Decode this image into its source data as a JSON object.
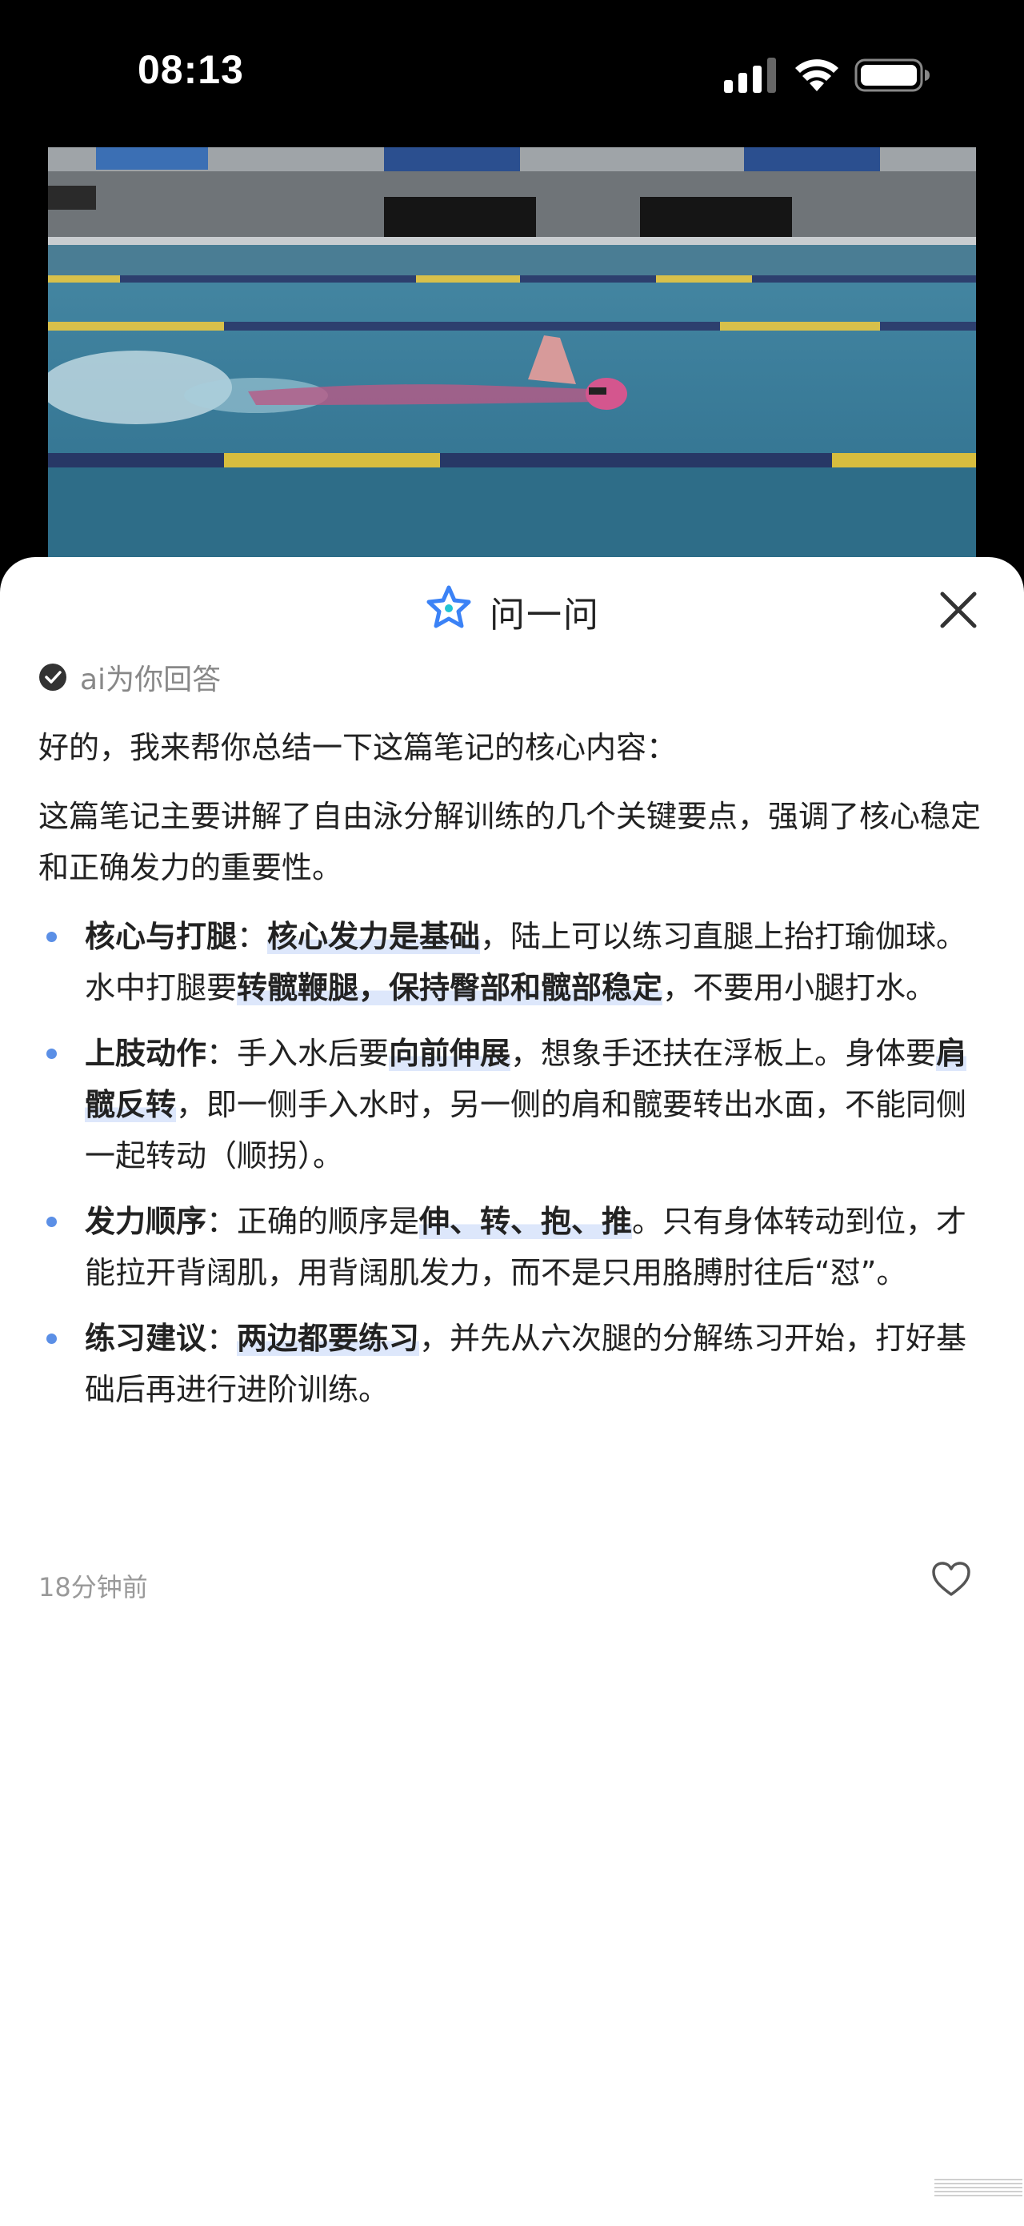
{
  "status_bar": {
    "time": "08:13"
  },
  "sheet": {
    "title": "问一问",
    "ai_label": "ai为你回答",
    "intro": "好的，我来帮你总结一下这篇笔记的核心内容：",
    "summary": "这篇笔记主要讲解了自由泳分解训练的几个关键要点，强调了核心稳定和正确发力的重要性。",
    "bullets": [
      {
        "title": "核心与打腿",
        "parts": [
          "：",
          "核心发力是基础",
          "，陆上可以练习直腿上抬打瑜伽球。水中打腿要",
          "转髋鞭腿，保持臀部和髋部稳定",
          "，不要用小腿打水。"
        ]
      },
      {
        "title": "上肢动作",
        "parts": [
          "：手入水后要",
          "向前伸展",
          "，想象手还扶在浮板上。身体要",
          "肩髋反转",
          "，即一侧手入水时，另一侧的肩和髋要转出水面，不能同侧一起转动（顺拐）。"
        ]
      },
      {
        "title": "发力顺序",
        "parts": [
          "：正确的顺序是",
          "伸、转、抱、推",
          "。只有身体转动到位，才能拉开背阔肌，用背阔肌发力，而不是只用胳膊肘往后“怼”。"
        ]
      },
      {
        "title": "练习建议",
        "parts": [
          "：",
          "两边都要练习",
          "，并先从六次腿的分解练习开始，打好基础后再进行进阶训练。"
        ]
      }
    ],
    "timestamp": "18分钟前"
  }
}
